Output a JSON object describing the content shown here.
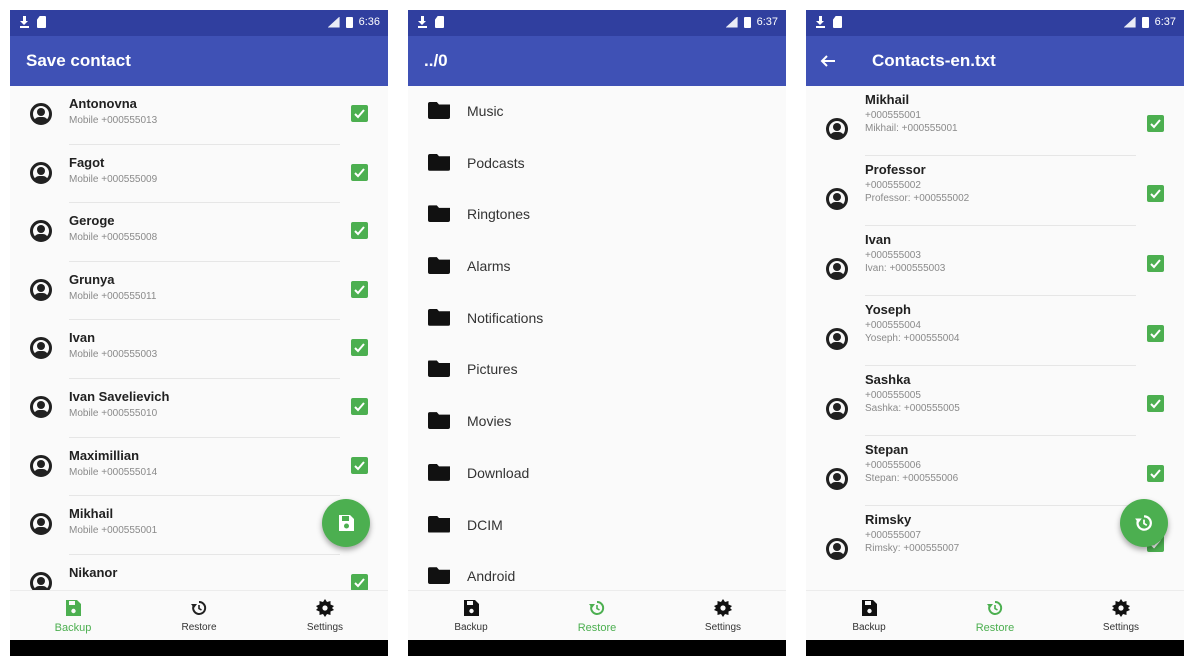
{
  "status_times": [
    "6:36",
    "6:37",
    "6:37"
  ],
  "colors": {
    "primary": "#3f51b5",
    "primary_dark": "#303f9f",
    "accent": "#4caf50"
  },
  "nav": {
    "backup": "Backup",
    "restore": "Restore",
    "settings": "Settings"
  },
  "screen1": {
    "title": "Save contact",
    "active_tab": "backup",
    "contacts": [
      {
        "name": "Antonovna",
        "phone": "Mobile +000555013"
      },
      {
        "name": "Fagot",
        "phone": "Mobile +000555009"
      },
      {
        "name": "Geroge",
        "phone": "Mobile +000555008"
      },
      {
        "name": "Grunya",
        "phone": "Mobile +000555011"
      },
      {
        "name": "Ivan",
        "phone": "Mobile +000555003"
      },
      {
        "name": "Ivan Savelievich",
        "phone": "Mobile +000555010"
      },
      {
        "name": "Maximillian",
        "phone": "Mobile +000555014"
      },
      {
        "name": "Mikhail",
        "phone": "Mobile +000555001"
      },
      {
        "name": "Nikanor",
        "phone": ""
      }
    ]
  },
  "screen2": {
    "title": "../0",
    "active_tab": "restore",
    "folders": [
      "Music",
      "Podcasts",
      "Ringtones",
      "Alarms",
      "Notifications",
      "Pictures",
      "Movies",
      "Download",
      "DCIM",
      "Android"
    ]
  },
  "screen3": {
    "title": "Contacts-en.txt",
    "active_tab": "restore",
    "contacts": [
      {
        "name": "Mikhail",
        "number": "+000555001",
        "detail": "Mikhail: +000555001"
      },
      {
        "name": "Professor",
        "number": "+000555002",
        "detail": "Professor: +000555002"
      },
      {
        "name": "Ivan",
        "number": "+000555003",
        "detail": "Ivan: +000555003"
      },
      {
        "name": "Yoseph",
        "number": "+000555004",
        "detail": "Yoseph: +000555004"
      },
      {
        "name": "Sashka",
        "number": "+000555005",
        "detail": "Sashka: +000555005"
      },
      {
        "name": "Stepan",
        "number": "+000555006",
        "detail": "Stepan: +000555006"
      },
      {
        "name": "Rimsky",
        "number": "+000555007",
        "detail": "Rimsky: +000555007"
      }
    ]
  }
}
